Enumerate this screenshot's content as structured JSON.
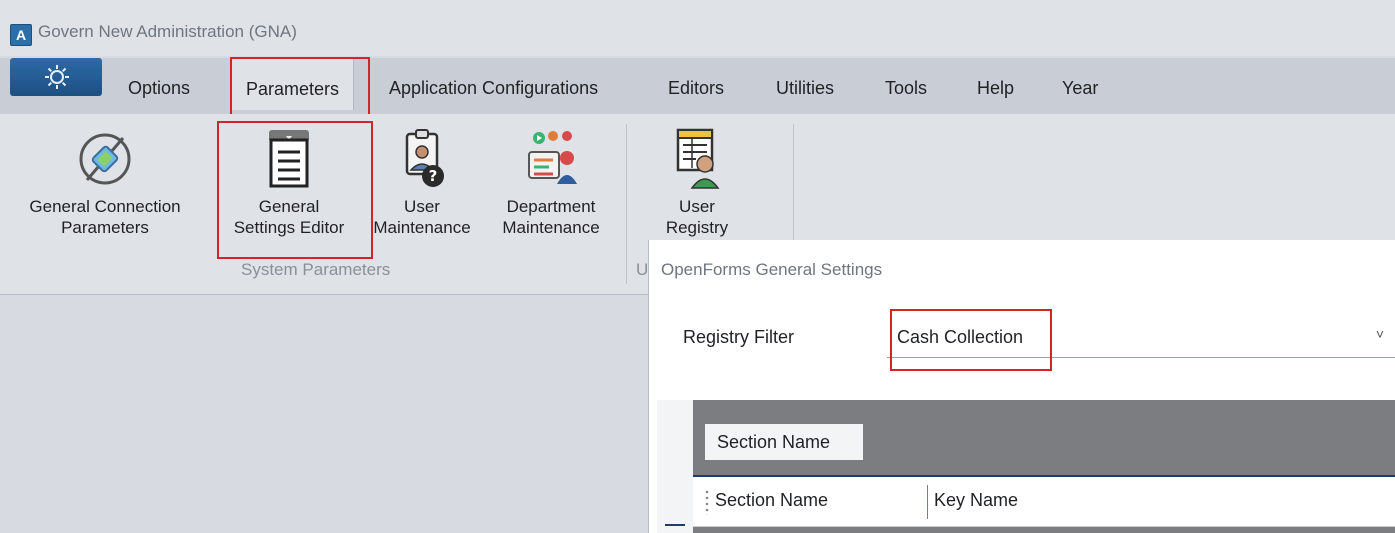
{
  "window": {
    "icon_letter": "A",
    "title": "Govern New Administration (GNA)"
  },
  "menu": {
    "app_button_icon": "gear-icon",
    "tabs": [
      "Options",
      "Parameters",
      "Application Configurations",
      "Editors",
      "Utilities",
      "Tools",
      "Help",
      "Year"
    ],
    "active_tab": "Parameters"
  },
  "ribbon": {
    "buttons": [
      {
        "label_line1": "General Connection",
        "label_line2": "Parameters",
        "icon": "connector-plug-icon"
      },
      {
        "label_line1": "General",
        "label_line2": "Settings Editor",
        "icon": "settings-document-icon"
      },
      {
        "label_line1": "User",
        "label_line2": "Maintenance",
        "icon": "user-help-icon"
      },
      {
        "label_line1": "Department",
        "label_line2": "Maintenance",
        "icon": "department-people-icon"
      },
      {
        "label_line1": "User",
        "label_line2": "Registry Editor",
        "icon": "user-registry-icon"
      }
    ],
    "group_label": "System Parameters",
    "second_group_label_fragment": "U"
  },
  "dialog": {
    "title": "OpenForms General Settings",
    "registry_filter_label": "Registry Filter",
    "registry_filter_value": "Cash Collection",
    "group_by_chip": "Section Name",
    "columns": [
      "Section Name",
      "Key Name"
    ]
  },
  "colors": {
    "highlight": "#d42424",
    "accent": "#2d6aa6",
    "grid_header_line": "#1f3b6e"
  }
}
